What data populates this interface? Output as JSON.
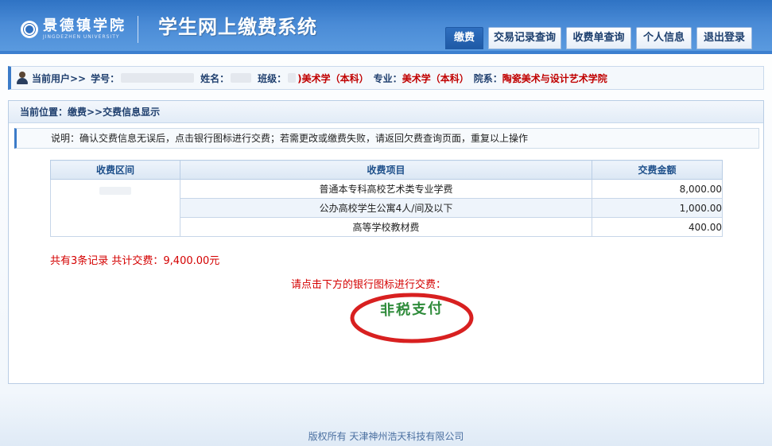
{
  "header": {
    "logo_cn": "景德镇学院",
    "logo_en": "JINGDEZHEN UNIVERSITY",
    "system_title": "学生网上缴费系统",
    "nav": [
      "缴费",
      "交易记录查询",
      "收费单查询",
      "个人信息",
      "退出登录"
    ],
    "active_nav": "缴费"
  },
  "userbar": {
    "current_user_label": "当前用户>>",
    "student_id_label": "学号：",
    "name_label": "姓名：",
    "class_label": "班级：",
    "class_value": ")美术学（本科）",
    "major_label": "专业：",
    "major_value": "美术学（本科）",
    "dept_label": "院系：",
    "dept_value": "陶瓷美术与设计艺术学院"
  },
  "breadcrumb": "当前位置：缴费>>交费信息显示",
  "note": "说明：确认交费信息无误后，点击银行图标进行交费；若需更改或缴费失败，请返回欠费查询页面，重复以上操作",
  "table": {
    "headers": [
      "收费区间",
      "收费项目",
      "交费金额"
    ],
    "rows": [
      {
        "item": "普通本专科高校艺术类专业学费",
        "amount": "8,000.00"
      },
      {
        "item": "公办高校学生公寓4人/间及以下",
        "amount": "1,000.00"
      },
      {
        "item": "高等学校教材费",
        "amount": "400.00"
      }
    ]
  },
  "summary": "共有3条记录  共计交费：9,400.00元",
  "pay_hint": "请点击下方的银行图标进行交费：",
  "pay_button": "非税支付",
  "footer": "版权所有 天津神州浩天科技有限公司",
  "colors": {
    "header_blue": "#2f73c4",
    "alert_red": "#d40000",
    "pay_green": "#2e8b3a",
    "pay_ring": "#d82020"
  }
}
